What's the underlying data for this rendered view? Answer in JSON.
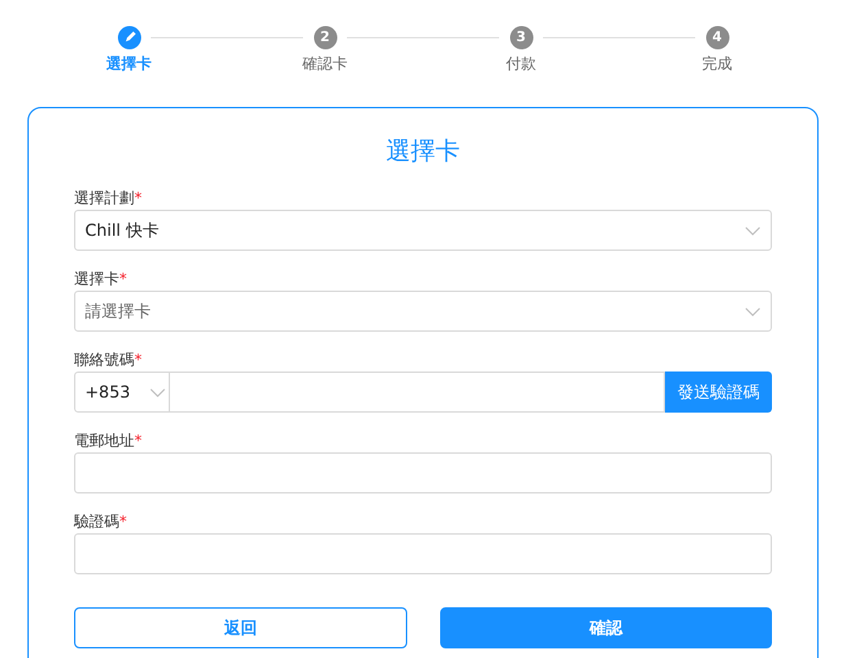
{
  "steps": [
    {
      "label": "選擇卡",
      "selected": true
    },
    {
      "label": "確認卡",
      "number": "2",
      "selected": false
    },
    {
      "label": "付款",
      "number": "3",
      "selected": false
    },
    {
      "label": "完成",
      "number": "4",
      "selected": false
    }
  ],
  "form": {
    "title": "選擇卡",
    "fields": [
      {
        "kind": "select",
        "label": "選擇計劃",
        "required_mark": "*",
        "value": "Chill 快卡"
      },
      {
        "kind": "select",
        "label": "選擇卡",
        "required_mark": "*",
        "placeholder": "請選擇卡"
      },
      {
        "kind": "phone",
        "label": "聯絡號碼",
        "required_mark": "*",
        "prefix": "+853",
        "button": "發送驗證碼"
      },
      {
        "kind": "text",
        "label": "電郵地址",
        "required_mark": "*"
      },
      {
        "kind": "text",
        "label": "驗證碼",
        "required_mark": "*"
      }
    ],
    "buttons": [
      {
        "label": "返回",
        "kind": "secondary"
      },
      {
        "label": "確認",
        "kind": "primary"
      }
    ]
  }
}
